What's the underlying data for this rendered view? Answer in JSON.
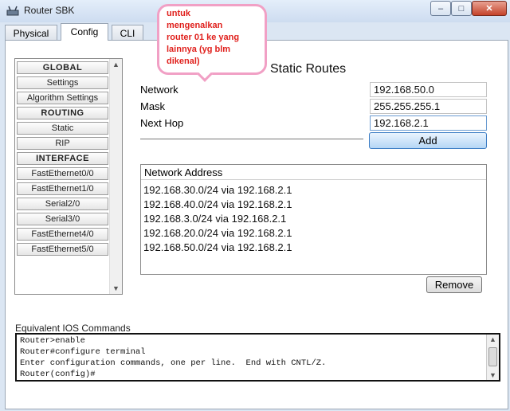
{
  "window": {
    "title": "Router SBK"
  },
  "window_controls": {
    "minimize": "–",
    "maximize": "□",
    "close": "✕"
  },
  "tabs": [
    {
      "label": "Physical"
    },
    {
      "label": "Config",
      "active": true
    },
    {
      "label": "CLI"
    }
  ],
  "sidebar": {
    "items": [
      {
        "label": "GLOBAL",
        "type": "header"
      },
      {
        "label": "Settings"
      },
      {
        "label": "Algorithm Settings"
      },
      {
        "label": "ROUTING",
        "type": "header"
      },
      {
        "label": "Static",
        "selected": true
      },
      {
        "label": "RIP"
      },
      {
        "label": "INTERFACE",
        "type": "header"
      },
      {
        "label": "FastEthernet0/0"
      },
      {
        "label": "FastEthernet1/0"
      },
      {
        "label": "Serial2/0"
      },
      {
        "label": "Serial3/0"
      },
      {
        "label": "FastEthernet4/0"
      },
      {
        "label": "FastEthernet5/0"
      }
    ]
  },
  "annotation": {
    "text": "untuk\nmengenalkan\nrouter 01 ke yang\nlainnya (yg blm\ndikenal)"
  },
  "static_routes": {
    "title": "Static Routes",
    "network_label": "Network",
    "network_value": "192.168.50.0",
    "mask_label": "Mask",
    "mask_value": "255.255.255.1",
    "nexthop_label": "Next Hop",
    "nexthop_value": "192.168.2.1",
    "add_label": "Add",
    "list_header": "Network Address",
    "routes": [
      "192.168.30.0/24 via 192.168.2.1",
      "192.168.40.0/24 via 192.168.2.1",
      "192.168.3.0/24 via 192.168.2.1",
      "192.168.20.0/24 via 192.168.2.1",
      "192.168.50.0/24 via 192.168.2.1"
    ],
    "remove_label": "Remove"
  },
  "ios": {
    "label": "Equivalent IOS Commands",
    "lines": [
      "Router>enable",
      "Router#configure terminal",
      "Enter configuration commands, one per line.  End with CNTL/Z.",
      "Router(config)#"
    ]
  },
  "colors": {
    "annotation_text": "#e0201c",
    "annotation_border": "#f1a0c5",
    "add_button": "#b5d6f5"
  }
}
